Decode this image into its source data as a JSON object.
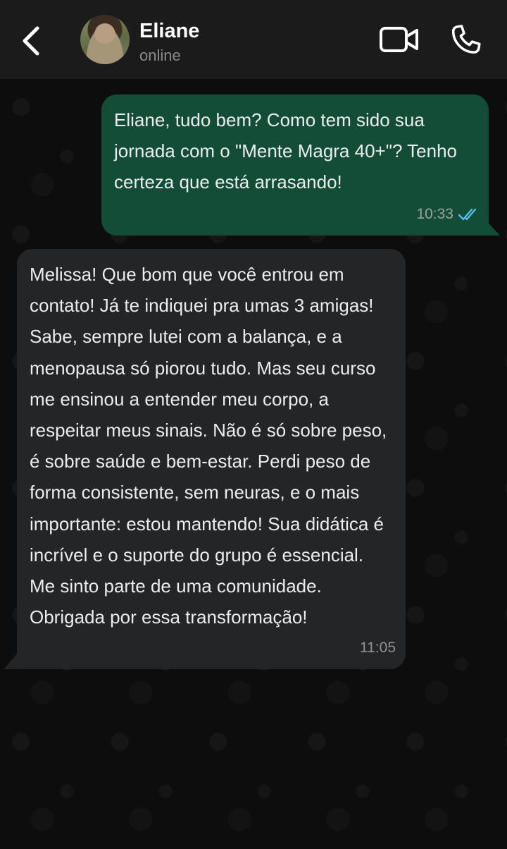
{
  "header": {
    "contact_name": "Eliane",
    "status": "online",
    "icons": {
      "back": "chevron-left-icon",
      "video": "video-camera-icon",
      "call": "phone-icon"
    }
  },
  "messages": [
    {
      "direction": "outgoing",
      "text": "Eliane, tudo bem? Como tem sido sua jornada com o \"Mente Magra 40+\"? Tenho certeza que está arrasando!",
      "time": "10:33",
      "read_receipt": "double-check-icon",
      "receipt_color": "#53bdeb"
    },
    {
      "direction": "incoming",
      "text": "Melissa! Que bom que você entrou em contato! Já te indiquei pra umas 3 amigas! Sabe, sempre lutei com a balança, e a menopausa só piorou tudo. Mas seu curso me ensinou a entender meu corpo, a respeitar meus sinais. Não é só sobre peso, é sobre saúde e bem-estar. Perdi peso de forma consistente, sem neuras, e o mais importante: estou mantendo! Sua didática é incrível e o suporte do grupo é essencial. Me sinto parte de uma comunidade. Obrigada por essa transformação!",
      "time": "11:05"
    }
  ],
  "colors": {
    "header_bg": "#1b1b1b",
    "outgoing_bubble": "#144d37",
    "incoming_bubble": "#232527"
  }
}
